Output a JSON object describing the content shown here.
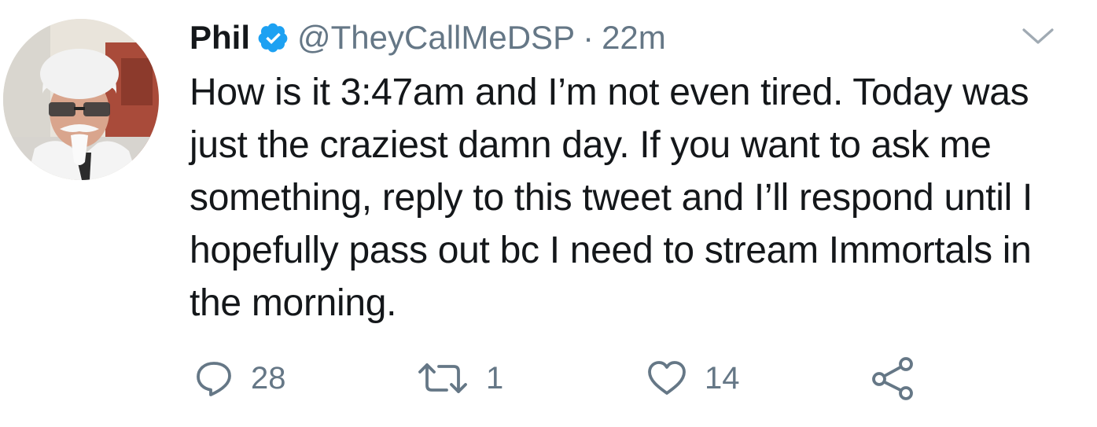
{
  "tweet": {
    "author": {
      "display_name": "Phil",
      "handle": "@TheyCallMeDSP",
      "verified": true,
      "avatar_icon": "user-avatar"
    },
    "separator": "·",
    "timestamp": "22m",
    "text": "How is it 3:47am and I’m not even tired. Today was just the craziest damn day. If you want to ask me something, reply to this tweet and I’ll respond until I hopefully pass out bc I need to stream Immortals in the morning.",
    "actions": {
      "reply": {
        "icon": "reply-icon",
        "count": "28"
      },
      "retweet": {
        "icon": "retweet-icon",
        "count": "1"
      },
      "like": {
        "icon": "heart-icon",
        "count": "14"
      },
      "share": {
        "icon": "share-icon"
      }
    },
    "menu_icon": "chevron-down-icon"
  },
  "colors": {
    "text_primary": "#14171a",
    "text_secondary": "#657786",
    "verified_blue": "#1da1f2"
  }
}
